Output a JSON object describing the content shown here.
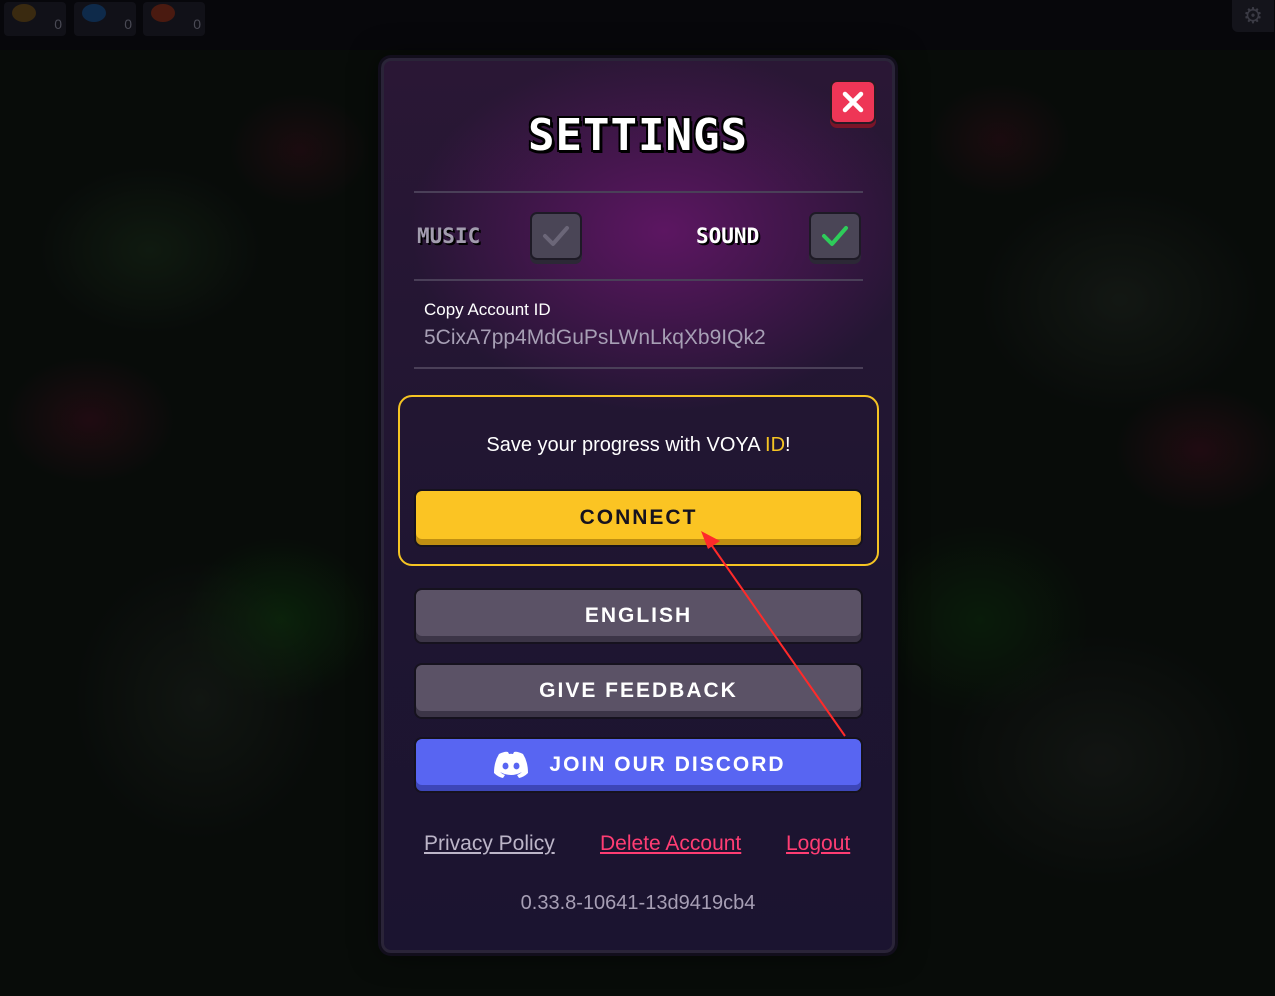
{
  "hud": {
    "resources": [
      {
        "icon": "gold-resource-icon",
        "value": "0"
      },
      {
        "icon": "gem-resource-icon",
        "value": "0"
      },
      {
        "icon": "fire-resource-icon",
        "value": "0"
      }
    ],
    "settings_icon": "gear-icon"
  },
  "settings": {
    "title": "SETTINGS",
    "music_label": "MUSIC",
    "music_enabled": false,
    "sound_label": "SOUND",
    "sound_enabled": true,
    "account_label": "Copy Account ID",
    "account_id": "5CixA7pp4MdGuPsLWnLkqXb9IQk2",
    "voya_prompt_prefix": "Save your progress with VOYA ",
    "voya_prompt_highlight": "ID",
    "voya_prompt_suffix": "!",
    "connect_label": "CONNECT",
    "language_label": "ENGLISH",
    "feedback_label": "GIVE FEEDBACK",
    "discord_label": "JOIN OUR DISCORD",
    "privacy_label": "Privacy Policy",
    "delete_label": "Delete Account",
    "logout_label": "Logout",
    "version": "0.33.8-10641-13d9419cb4"
  },
  "colors": {
    "accent_yellow": "#fbc423",
    "discord_blue": "#5865f2",
    "danger_red": "#ee3656",
    "check_green": "#2ecc5a",
    "link_red": "#ff3d73",
    "link_grey": "#bcb5c8"
  }
}
